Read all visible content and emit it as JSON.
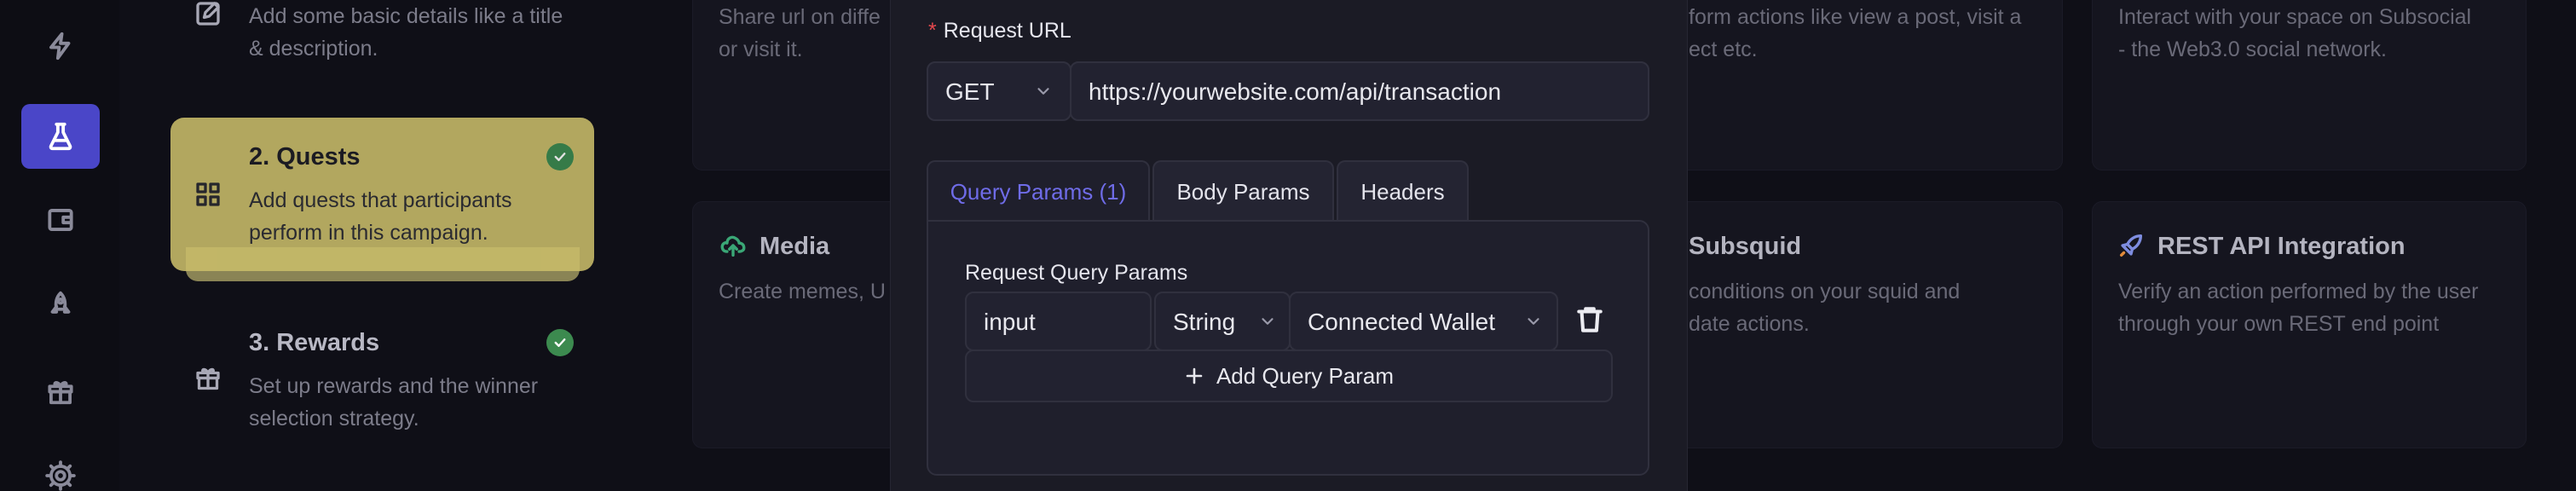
{
  "sidebar": {
    "icons": [
      "bolt-icon",
      "flask-icon",
      "wallet-icon",
      "rocket-icon",
      "gift-icon",
      "gear-icon"
    ],
    "active": "flask-icon"
  },
  "steps": [
    {
      "title": "",
      "desc": "Add some basic details like a title & description.",
      "icon": "edit-icon"
    },
    {
      "title": "2. Quests",
      "desc": "Add quests that participants perform in this campaign.",
      "icon": "grid-icon",
      "done": true,
      "active": true
    },
    {
      "title": "3. Rewards",
      "desc": "Set up rewards and the winner selection strategy.",
      "icon": "gift-icon",
      "done": true
    }
  ],
  "cards": {
    "share": {
      "desc": "Share url on diffe\nor visit it."
    },
    "platform": {
      "desc": "form actions like view a post, visit a\nect etc."
    },
    "subsocial": {
      "desc": "Interact with your space on Subsocial\n- the Web3.0 social network."
    },
    "media": {
      "title": "Media",
      "desc": "Create memes, U"
    },
    "subsquid": {
      "title": "Subsquid",
      "desc": "conditions on your squid and\ndate actions."
    },
    "rest": {
      "title": "REST API Integration",
      "desc": "Verify an action performed by the user\nthrough your own REST end point"
    }
  },
  "modal": {
    "url_label": "Request URL",
    "required_mark": "*",
    "method": "GET",
    "url": "https://yourwebsite.com/api/transaction",
    "tabs": [
      {
        "label": "Query Params (1)",
        "active": true
      },
      {
        "label": "Body Params"
      },
      {
        "label": "Headers"
      }
    ],
    "query_section_label": "Request Query Params",
    "param": {
      "name": "input",
      "type": "String",
      "source": "Connected Wallet"
    },
    "add_label": "Add Query Param"
  },
  "colors": {
    "accent": "#6f6ce8",
    "active_step": "#c9bd6a",
    "rail_active": "#4a46c8",
    "success": "#3c8a4f",
    "required": "#e5484d"
  }
}
